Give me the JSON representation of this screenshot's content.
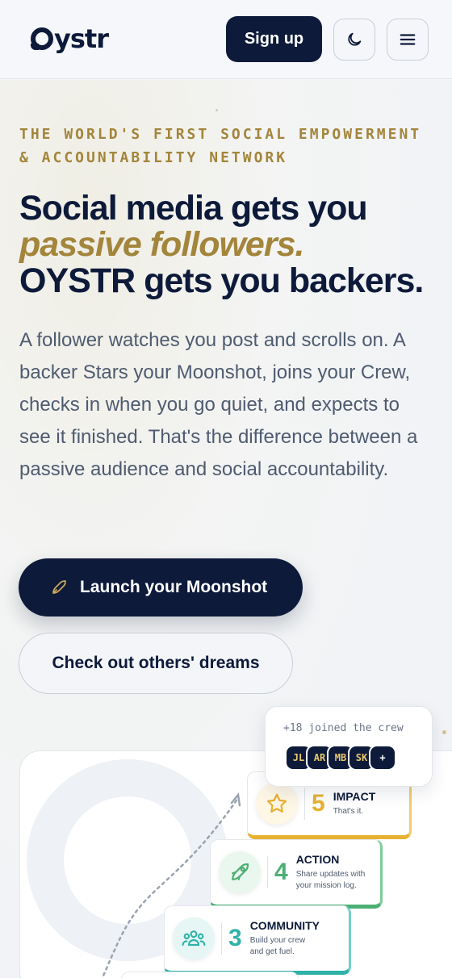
{
  "header": {
    "logo_text": "ystr",
    "signup_label": "Sign up",
    "theme_icon": "moon-icon",
    "menu_icon": "hamburger-icon"
  },
  "hero": {
    "eyebrow": "THE WORLD'S FIRST SOCIAL EMPOWERMENT & ACCOUNTABILITY NETWORK",
    "headline_line1": "Social media gets you",
    "headline_accent": "passive followers.",
    "headline_line3": "OYSTR gets you backers.",
    "body": "A follower watches you post and scrolls on. A backer Stars your Moonshot, joins your Crew, checks in when you go quiet, and expects to see it finished. That's the difference between a passive audience and social accountability.",
    "cta_primary": "Launch your Moonshot",
    "cta_secondary": "Check out others' dreams"
  },
  "crew": {
    "label": "+18 joined the crew",
    "avatars": [
      "JL",
      "AR",
      "MB",
      "SK",
      "+"
    ]
  },
  "steps": [
    {
      "num": "5",
      "title": "IMPACT",
      "desc1": "That's it.",
      "desc2": "",
      "icon": "star-icon",
      "color": "#e8b131"
    },
    {
      "num": "4",
      "title": "ACTION",
      "desc1": "Share updates with",
      "desc2": "your mission log.",
      "icon": "rocket-icon",
      "color": "#4caf74"
    },
    {
      "num": "3",
      "title": "COMMUNITY",
      "desc1": "Build your crew",
      "desc2": "and get fuel.",
      "icon": "people-icon",
      "color": "#2fb3a8"
    }
  ],
  "colors": {
    "navy": "#0d1a3a",
    "gold": "#a3853b"
  }
}
